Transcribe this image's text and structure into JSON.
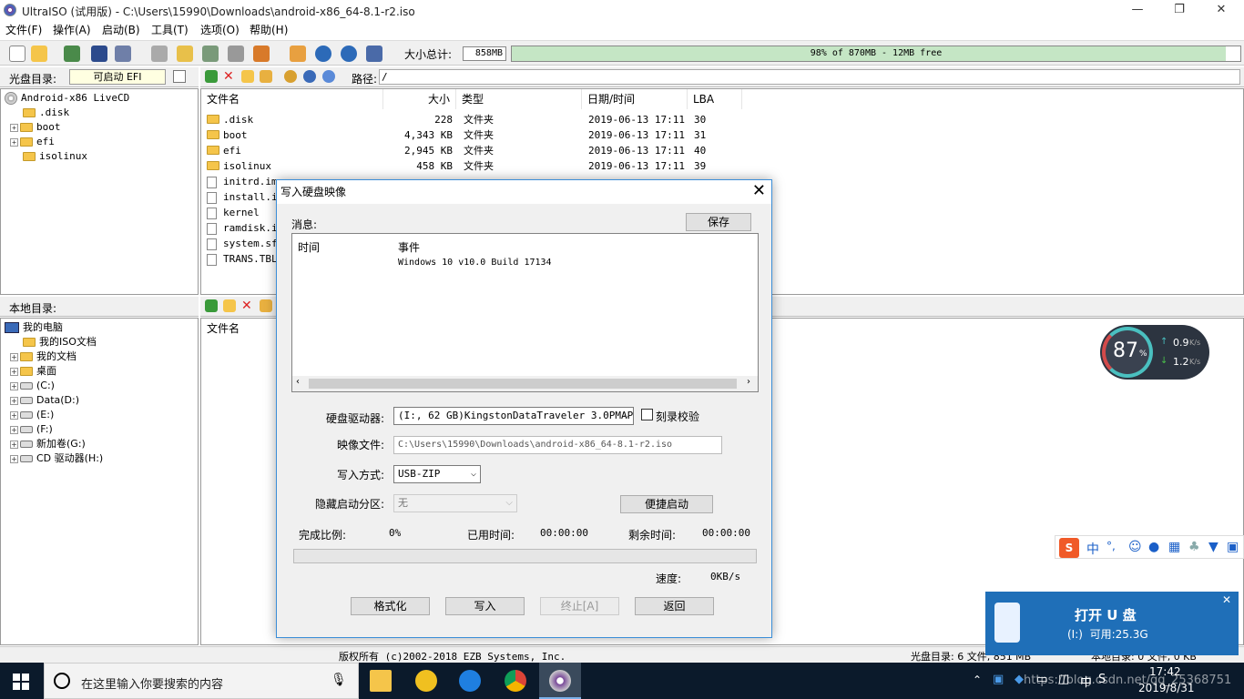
{
  "window": {
    "title": "UltraISO (试用版) - C:\\Users\\15990\\Downloads\\android-x86_64-8.1-r2.iso",
    "minimize": "—",
    "restore": "❐",
    "close": "✕"
  },
  "menu": [
    "文件(F)",
    "操作(A)",
    "启动(B)",
    "工具(T)",
    "选项(O)",
    "帮助(H)"
  ],
  "toolbar": {
    "size_label": "大小总计:",
    "size_value": "858MB",
    "capacity_text": "98% of 870MB - 12MB free",
    "capacity_fraction": 0.98
  },
  "iso_panel": {
    "header_label": "光盘目录:",
    "boot_label": "可启动 EFI",
    "path_label": "路径:",
    "path_value": "/",
    "tree": [
      {
        "label": "Android-x86 LiveCD",
        "kind": "disc"
      },
      {
        "label": ".disk",
        "kind": "folder"
      },
      {
        "label": "boot",
        "kind": "folder"
      },
      {
        "label": "efi",
        "kind": "folder"
      },
      {
        "label": "isolinux",
        "kind": "folder"
      }
    ],
    "columns": [
      "文件名",
      "大小",
      "类型",
      "日期/时间",
      "LBA"
    ],
    "files": [
      {
        "name": ".disk",
        "size": "228",
        "type": "文件夹",
        "date": "2019-06-13 17:11",
        "lba": "30"
      },
      {
        "name": "boot",
        "size": "4,343 KB",
        "type": "文件夹",
        "date": "2019-06-13 17:11",
        "lba": "31"
      },
      {
        "name": "efi",
        "size": "2,945 KB",
        "type": "文件夹",
        "date": "2019-06-13 17:11",
        "lba": "40"
      },
      {
        "name": "isolinux",
        "size": "458 KB",
        "type": "文件夹",
        "date": "2019-06-13 17:11",
        "lba": "39"
      },
      {
        "name": "initrd.img",
        "size": "",
        "type": "",
        "date": "",
        "lba": ""
      },
      {
        "name": "install.img",
        "size": "",
        "type": "",
        "date": "",
        "lba": ""
      },
      {
        "name": "kernel",
        "size": "",
        "type": "",
        "date": "",
        "lba": ""
      },
      {
        "name": "ramdisk.img",
        "size": "",
        "type": "",
        "date": "",
        "lba": ""
      },
      {
        "name": "system.sfs",
        "size": "",
        "type": "",
        "date": "",
        "lba": ""
      },
      {
        "name": "TRANS.TBL",
        "size": "",
        "type": "",
        "date": "",
        "lba": ""
      }
    ]
  },
  "local_panel": {
    "header_label": "本地目录:",
    "tree": [
      {
        "label": "我的电脑",
        "kind": "pc"
      },
      {
        "label": "我的ISO文档",
        "kind": "folder"
      },
      {
        "label": "我的文档",
        "kind": "folder"
      },
      {
        "label": "桌面",
        "kind": "folder"
      },
      {
        "label": "(C:)",
        "kind": "drive"
      },
      {
        "label": "Data(D:)",
        "kind": "drive"
      },
      {
        "label": "(E:)",
        "kind": "drive"
      },
      {
        "label": "(F:)",
        "kind": "drive"
      },
      {
        "label": "新加卷(G:)",
        "kind": "drive"
      },
      {
        "label": "CD 驱动器(H:)",
        "kind": "drive"
      }
    ],
    "column": "文件名"
  },
  "dialog": {
    "title": "写入硬盘映像",
    "close": "✕",
    "messages_label": "消息:",
    "save_button": "保存",
    "log_col_time": "时间",
    "log_col_event": "事件",
    "log_event": "Windows 10 v10.0 Build 17134",
    "drive_label": "硬盘驱动器:",
    "drive_value": "(I:, 62 GB)KingstonDataTraveler 3.0PMAP",
    "verify_label": "刻录校验",
    "image_label": "映像文件:",
    "image_value": "C:\\Users\\15990\\Downloads\\android-x86_64-8.1-r2.iso",
    "method_label": "写入方式:",
    "method_value": "USB-ZIP",
    "hidden_label": "隐藏启动分区:",
    "hidden_value": "无",
    "quickboot_button": "便捷启动",
    "progress_label": "完成比例:",
    "progress_value": "0%",
    "elapsed_label": "已用时间:",
    "elapsed_value": "00:00:00",
    "remaining_label": "剩余时间:",
    "remaining_value": "00:00:00",
    "speed_label": "速度:",
    "speed_value": "0KB/s",
    "format_button": "格式化",
    "write_button": "写入",
    "stop_button": "终止[A]",
    "back_button": "返回"
  },
  "statusbar": {
    "copyright": "版权所有 (c)2002-2018 EZB Systems, Inc.",
    "iso_stats": "光盘目录: 6 文件, 851 MB",
    "local_stats": "本地目录: 0 文件, 0 KB"
  },
  "net_widget": {
    "percent": "87",
    "percent_unit": "%",
    "up": "0.9",
    "down": "1.2",
    "unit": "K/s"
  },
  "ime_bar": {
    "lang": "中",
    "punct": "°,"
  },
  "usb_popup": {
    "title": "打开 U 盘",
    "info": "(I:)  可用:25.3G"
  },
  "taskbar": {
    "search_placeholder": "在这里输入你要搜索的内容",
    "time": "17:42",
    "date": "2019/8/31",
    "ime": "中",
    "watermark": "https://blog.csdn.net/qq_25368751"
  },
  "colors": {
    "accent": "#3b8ed8",
    "capacity_fill": "#c5e6c5",
    "taskbar": "#0b1a2b",
    "usb_popup": "#1f6fb8"
  }
}
